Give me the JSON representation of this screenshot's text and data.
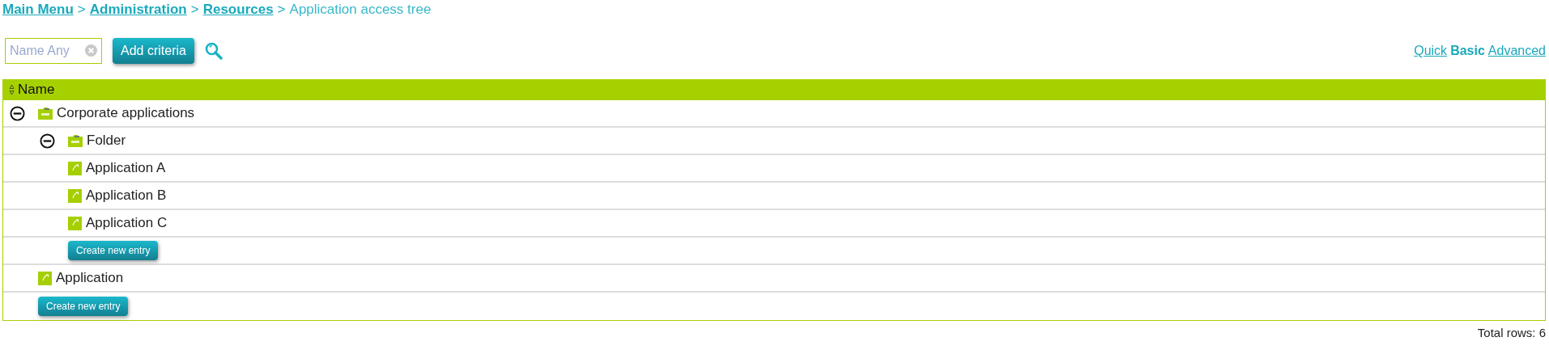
{
  "breadcrumb": {
    "links": [
      "Main Menu",
      "Administration",
      "Resources"
    ],
    "separator": ">",
    "current": "Application access tree"
  },
  "filter": {
    "placeholder": "Name Any",
    "button": "Add criteria"
  },
  "modes": [
    {
      "label": "Quick",
      "selected": false
    },
    {
      "label": "Basic",
      "selected": true
    },
    {
      "label": "Advanced",
      "selected": false
    }
  ],
  "table": {
    "column": "Name",
    "rows": [
      {
        "kind": "folder",
        "label": "Corporate applications",
        "expanded": true,
        "children": [
          {
            "kind": "folder",
            "label": "Folder",
            "expanded": true,
            "children": [
              {
                "kind": "application",
                "label": "Application A"
              },
              {
                "kind": "application",
                "label": "Application B"
              },
              {
                "kind": "application",
                "label": "Application C"
              },
              {
                "kind": "create",
                "label": "Create new entry"
              }
            ]
          },
          {
            "kind": "application",
            "label": "Application"
          },
          {
            "kind": "create",
            "label": "Create new entry"
          }
        ]
      }
    ]
  },
  "total": "Total rows: 6"
}
